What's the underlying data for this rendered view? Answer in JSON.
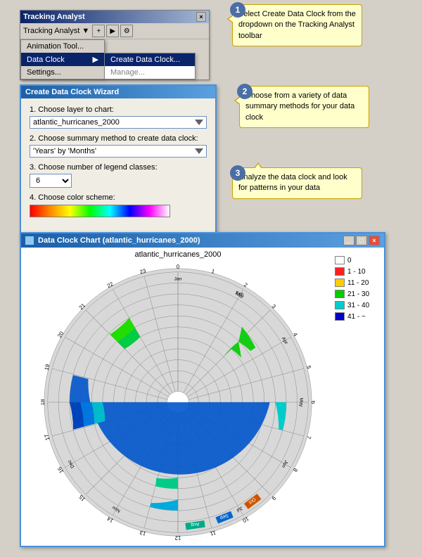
{
  "toolbar": {
    "title": "Tracking Analyst",
    "close_label": "×",
    "label": "Tracking Analyst ▼",
    "anim_tool": "Animation Tool...",
    "menu_items": [
      "Data Clock",
      "Settings..."
    ],
    "data_clock_arrow": "▶",
    "submenu_items": [
      "Create Data Clock...",
      "Manage..."
    ]
  },
  "callout1": {
    "number": "1",
    "text": "Select Create Data Clock from the dropdown on the Tracking Analyst toolbar"
  },
  "wizard": {
    "title": "Create Data Clock Wizard",
    "step1_label": "1. Choose layer to chart:",
    "step1_value": "atlantic_hurricanes_2000",
    "step2_label": "2. Choose summary method to create data clock:",
    "step2_value": "'Years' by 'Months'",
    "step3_label": "3. Choose number of legend classes:",
    "step3_value": "6",
    "step4_label": "4. Choose color scheme:"
  },
  "callout2": {
    "number": "2",
    "text": "Choose from a variety of data summary methods for your data clock"
  },
  "callout3": {
    "number": "3",
    "text": "Analyze the data clock and look for patterns in your data"
  },
  "chart": {
    "title": "Data Clock Chart (atlantic_hurricanes_2000)",
    "subtitle": "atlantic_hurricanes_2000",
    "legend": [
      {
        "label": "0",
        "color": "#ffffff"
      },
      {
        "label": "1 - 10",
        "color": "#ff2020"
      },
      {
        "label": "11 - 20",
        "color": "#ffcc00"
      },
      {
        "label": "21 - 30",
        "color": "#00cc00"
      },
      {
        "label": "31 - 40",
        "color": "#00cccc"
      },
      {
        "label": "41 - ~",
        "color": "#0000cc"
      }
    ],
    "months": [
      "Jan",
      "Feb",
      "Mar",
      "Apr",
      "May",
      "Jun",
      "Jul",
      "Aug",
      "Sep",
      "Oct",
      "Nov",
      "Dec"
    ],
    "hours": [
      "0",
      "1",
      "2",
      "3",
      "4",
      "5",
      "6",
      "7",
      "8",
      "9",
      "10",
      "11",
      "12",
      "13",
      "14",
      "15",
      "16",
      "17",
      "18",
      "19",
      "20",
      "21",
      "22",
      "23"
    ]
  }
}
